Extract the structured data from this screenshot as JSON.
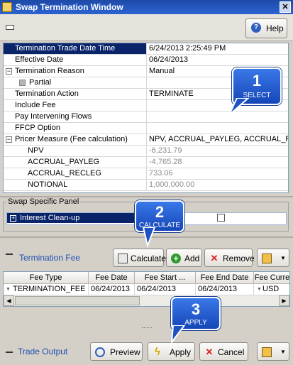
{
  "window": {
    "title": "Swap Termination Window"
  },
  "toolbar": {
    "help_label": "Help"
  },
  "properties": [
    {
      "label": "Termination Trade Date Time",
      "value": "6/24/2013 2:25:49 PM"
    },
    {
      "label": "Effective Date",
      "value": "06/24/2013"
    },
    {
      "label": "Termination Reason",
      "value": "Manual"
    },
    {
      "label": "Partial",
      "value": "",
      "checked": false
    },
    {
      "label": "Termination Action",
      "value": "TERMINATE"
    },
    {
      "label": "Include Fee",
      "value": "",
      "checked": true
    },
    {
      "label": "Pay Intervening Flows",
      "value": "",
      "checked": true
    },
    {
      "label": "FFCP Option",
      "value": "",
      "checked": true
    },
    {
      "label": "Pricer Measure (Fee calculation)",
      "value": "NPV, ACCRUAL_PAYLEG, ACCRUAL_R..."
    },
    {
      "label": "NPV",
      "value": "-6,231.79"
    },
    {
      "label": "ACCRUAL_PAYLEG",
      "value": "-4,765.28"
    },
    {
      "label": "ACCRUAL_RECLEG",
      "value": "733.06"
    },
    {
      "label": "NOTIONAL",
      "value": "1,000,000.00"
    }
  ],
  "swap_panel": {
    "legend": "Swap Specific Panel",
    "interest_label": "Interest Clean-up",
    "interest_checked": false
  },
  "fee_section": {
    "title": "Termination Fee",
    "calculate_label": "Calculate",
    "add_label": "Add",
    "remove_label": "Remove"
  },
  "fee_table": {
    "columns": [
      "Fee Type",
      "Fee Date",
      "Fee Start ...",
      "Fee End Date",
      "Fee Curre"
    ],
    "rows": [
      [
        "TERMINATION_FEE",
        "06/24/2013",
        "06/24/2013",
        "06/24/2013",
        "USD"
      ]
    ]
  },
  "trade_output": {
    "title": "Trade Output",
    "preview_label": "Preview",
    "apply_label": "Apply",
    "cancel_label": "Cancel"
  },
  "callouts": [
    {
      "number": "1",
      "word": "SELECT"
    },
    {
      "number": "2",
      "word": "CALCULATE"
    },
    {
      "number": "3",
      "word": "APPLY"
    }
  ],
  "colors": {
    "title_bar": "#2b63d1",
    "selection": "#0a246a",
    "callout": "#2a63d6",
    "section_label": "#1f4fb0"
  }
}
